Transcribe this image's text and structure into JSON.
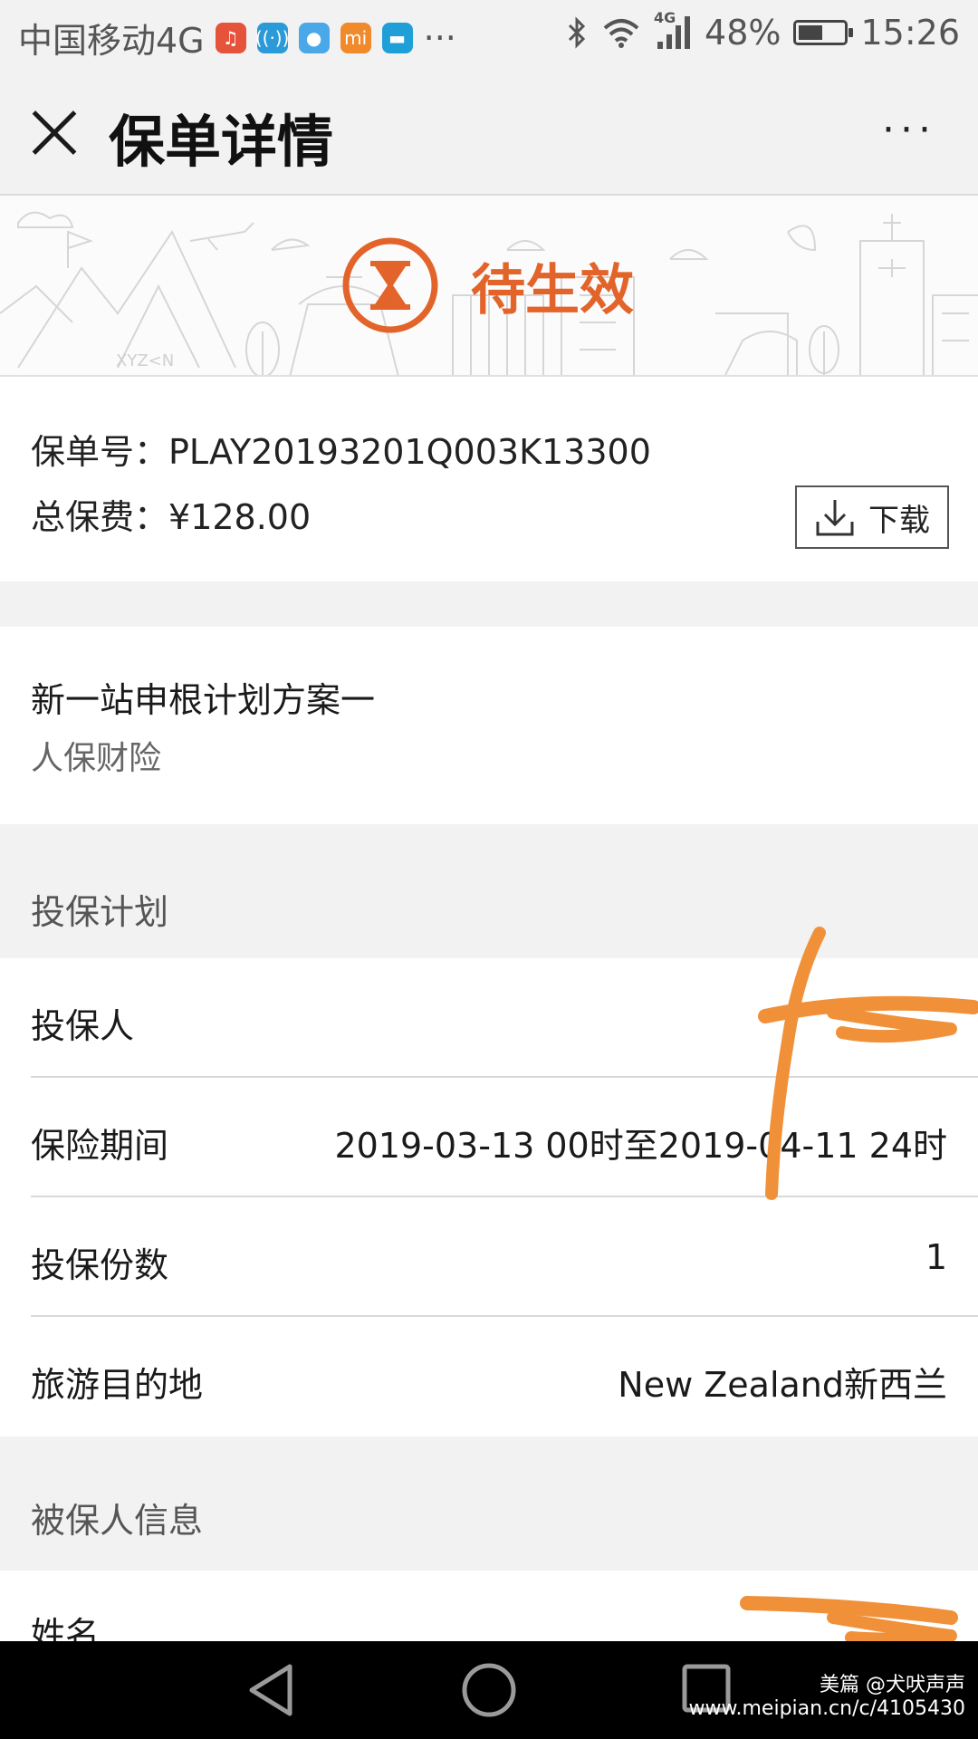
{
  "status_bar": {
    "carrier": "中国移动4G",
    "more": "···",
    "network": "4G",
    "battery_percent": "48%",
    "battery_level": 0.48,
    "time": "15:26",
    "app_icons": [
      "music-app-icon",
      "wifi-app-icon",
      "location-app-icon",
      "mi-app-icon",
      "message-app-icon"
    ]
  },
  "navbar": {
    "title": "保单详情",
    "close_icon": "close-icon",
    "more_icon": "more-icon",
    "more_glyph": "···"
  },
  "banner": {
    "status": "待生效",
    "status_color": "#e2642a",
    "status_icon": "hourglass-icon"
  },
  "policy": {
    "number_label": "保单号：",
    "number": "PLAY20193201Q003K13300",
    "premium_label": "总保费：",
    "premium": "¥128.00",
    "download_label": "下载",
    "download_icon": "download-icon"
  },
  "plan": {
    "name": "新一站申根计划方案一",
    "company": "人保财险"
  },
  "insurance_plan": {
    "title": "投保计划",
    "rows": [
      {
        "label": "投保人",
        "value": ""
      },
      {
        "label": "保险期间",
        "value": "2019-03-13 00时至2019-04-11 24时"
      },
      {
        "label": "投保份数",
        "value": "1"
      },
      {
        "label": "旅游目的地",
        "value": "New Zealand新西兰"
      }
    ]
  },
  "insured_info": {
    "title": "被保人信息",
    "rows": [
      {
        "label": "姓名",
        "value": ""
      }
    ]
  },
  "watermark": {
    "line1": "美篇 @犬吠声声",
    "line2": "www.meipian.cn/c/4105430"
  },
  "colors": {
    "accent": "#e2642a",
    "scribble": "#f0913a"
  }
}
